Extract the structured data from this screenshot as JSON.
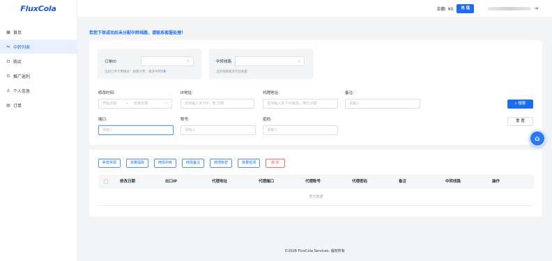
{
  "app": {
    "logo": "FluxCola"
  },
  "sidebar": {
    "items": [
      {
        "icon": "▦",
        "label": "首页"
      },
      {
        "icon": "⇋",
        "label": "中转列表"
      },
      {
        "icon": "⊡",
        "label": "购买"
      },
      {
        "icon": "⊡",
        "label": "推广返利"
      },
      {
        "icon": "♙",
        "label": "个人信息"
      },
      {
        "icon": "▤",
        "label": "订单"
      }
    ],
    "active_index": 1
  },
  "header": {
    "balance": "余额: ¥0",
    "recharge_label": "充 值",
    "logout_icon": "⇥"
  },
  "notice": "若您下单成功后未分配中转线路，请联系客服处理！",
  "filters": {
    "order_id": {
      "label": "订单ID",
      "arrow": "∨",
      "hint_prefix": "当前订单计费模式：按量计费，最多中转",
      "hint_link": "1条"
    },
    "transit_line": {
      "label": "中转线路",
      "arrow": "∨",
      "hint": "当前线路最多可设备置"
    },
    "modify_time": {
      "label": "修改时间:",
      "start_placeholder": "开始日期",
      "separator": "→",
      "end_placeholder": "结束日期",
      "calendar_icon": "▭"
    },
    "ip_address": {
      "label": "IP地址:",
      "placeholder": "支持输入多个IP，按,分隔"
    },
    "proxy_address": {
      "label": "代理地址:",
      "placeholder": "支持输入多个IP/域名，换行分隔"
    },
    "remark": {
      "label": "备注:",
      "placeholder": "请输入"
    },
    "port": {
      "label": "端口:",
      "placeholder": "请输入"
    },
    "account": {
      "label": "账号:",
      "placeholder": "请输入"
    },
    "password": {
      "label": "密码:",
      "placeholder": "请输入"
    },
    "search_label": "⌕ 搜索",
    "reset_label": "重 置"
  },
  "support_icon": "⌂",
  "table": {
    "actions": [
      "新增资源",
      "批量提取",
      "修改中转",
      "修改备注",
      "修改账密",
      "批量检测",
      "删 除"
    ],
    "columns": [
      "修改日期",
      "出口IP",
      "代理地址",
      "代理端口",
      "代理账号",
      "代理密码",
      "备注",
      "中转线路",
      "操作"
    ],
    "empty_text": "暂无数据"
  },
  "footer": "©2026 FluxCola Services. 版权所有"
}
